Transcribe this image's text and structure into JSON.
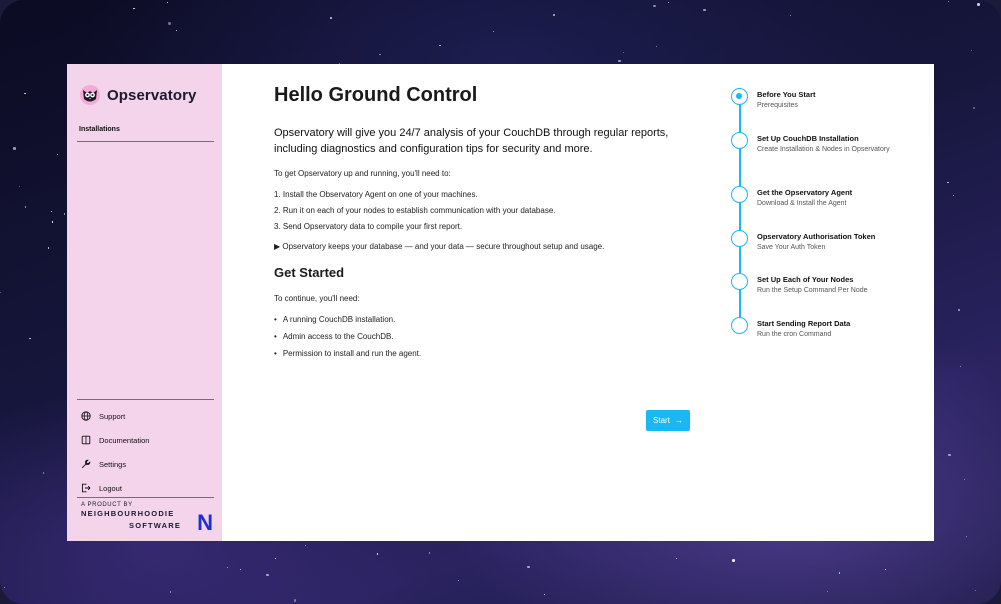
{
  "brand": {
    "name": "Opservatory"
  },
  "sidebar": {
    "section_label": "Installations",
    "nav": [
      {
        "label": "Support",
        "icon": "globe-icon"
      },
      {
        "label": "Documentation",
        "icon": "book-icon"
      },
      {
        "label": "Settings",
        "icon": "wrench-icon"
      },
      {
        "label": "Logout",
        "icon": "logout-icon"
      }
    ],
    "producer": {
      "top": "A PRODUCT BY",
      "line1": "NEIGHBOURHOODIE",
      "line2": "SOFTWARE",
      "mark": "N"
    }
  },
  "main": {
    "title": "Hello Ground Control",
    "lead": "Opservatory will give you 24/7 analysis of your CouchDB through regular reports, including diagnostics and configuration tips for security and more.",
    "intro": "To get Opservatory up and running, you'll need to:",
    "steps_list": [
      "1. Install the Observatory Agent on one of your machines.",
      "2. Run it on each of your nodes to establish communication with your database.",
      "3. Send Opservatory data to compile your first report."
    ],
    "note": "▶ Opservatory keeps your database — and your data — secure throughout setup and usage.",
    "get_started": "Get Started",
    "continue_text": "To continue, you'll need:",
    "requirements": [
      "A running CouchDB installation.",
      "Admin access to the CouchDB.",
      "Permission to install and run the agent."
    ],
    "start_label": "Start",
    "start_arrow": "→"
  },
  "wizard": [
    {
      "title": "Before You Start",
      "sub": "Prerequisites",
      "active": true
    },
    {
      "title": "Set Up CouchDB Installation",
      "sub": "Create Installation & Nodes in Opservatory",
      "active": false
    },
    {
      "title": "Get the Opservatory Agent",
      "sub": "Download & Install the Agent",
      "active": false
    },
    {
      "title": "Opservatory Authorisation Token",
      "sub": "Save Your Auth Token",
      "active": false
    },
    {
      "title": "Set Up Each of Your Nodes",
      "sub": "Run the Setup Command Per Node",
      "active": false
    },
    {
      "title": "Start Sending Report Data",
      "sub": "Run the cron Command",
      "active": false
    }
  ],
  "colors": {
    "accent": "#1ab7f2",
    "sidebar_bg": "#f3d4ea",
    "brand_mark": "#1c2fd6"
  }
}
